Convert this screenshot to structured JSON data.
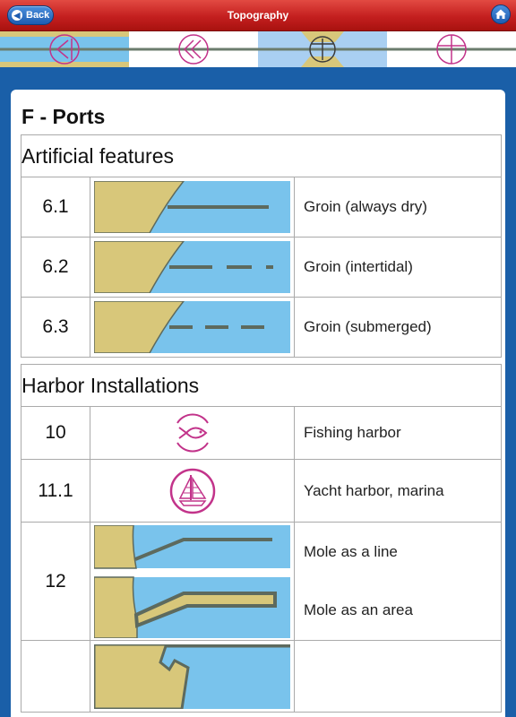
{
  "header": {
    "title": "Topography",
    "back_label": "Back"
  },
  "tabs": [
    {
      "icon": "arrow-chevron-icon",
      "selected": false
    },
    {
      "icon": "double-chevron-icon",
      "selected": false
    },
    {
      "icon": "bridge-icon",
      "selected": true
    },
    {
      "icon": "cross-circle-icon",
      "selected": false
    }
  ],
  "page": {
    "section_title": "F - Ports"
  },
  "groups": [
    {
      "heading": "Artificial features",
      "rows": [
        {
          "number": "6.1",
          "description": "Groin (always dry)",
          "icon": "groin-solid-icon"
        },
        {
          "number": "6.2",
          "description": "Groin (intertidal)",
          "icon": "groin-dashed-icon"
        },
        {
          "number": "6.3",
          "description": "Groin (submerged)",
          "icon": "groin-dotted-icon"
        }
      ]
    },
    {
      "heading": "Harbor Installations",
      "rows": [
        {
          "number": "10",
          "description": "Fishing harbor",
          "icon": "fish-icon"
        },
        {
          "number": "11.1",
          "description": "Yacht harbor, marina",
          "icon": "sailboat-icon"
        },
        {
          "number": "12",
          "descriptions": [
            "Mole as a line",
            "Mole as an area"
          ],
          "icon": "mole-icon"
        }
      ]
    }
  ],
  "colors": {
    "land": "#d8c77a",
    "water": "#79c3ec",
    "magenta": "#c2338a",
    "line": "#5d6a5e"
  }
}
